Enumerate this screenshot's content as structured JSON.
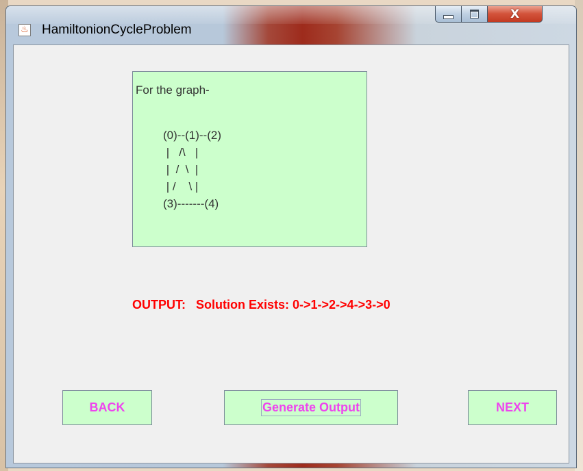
{
  "window": {
    "title": "HamiltonionCycleProblem",
    "icon": "java-cup-icon",
    "controls": {
      "minimize": "minimize-icon",
      "maximize": "maximize-icon",
      "close": "close-icon",
      "close_glyph": "X"
    }
  },
  "graph": {
    "heading": "For the graph-",
    "lines": [
      "(0)--(1)--(2)",
      " |   /\\   |",
      " |  /  \\  |",
      " | /    \\ |",
      "(3)-------(4)"
    ]
  },
  "output": {
    "text": "OUTPUT:   Solution Exists: 0->1->2->4->3->0"
  },
  "buttons": {
    "back": "BACK",
    "generate": "Generate Output",
    "next": "NEXT"
  },
  "colors": {
    "panel_bg": "#ccffcc",
    "button_text": "#ee44ee",
    "output_text": "#ff0000",
    "client_bg": "#f0f0f0"
  }
}
